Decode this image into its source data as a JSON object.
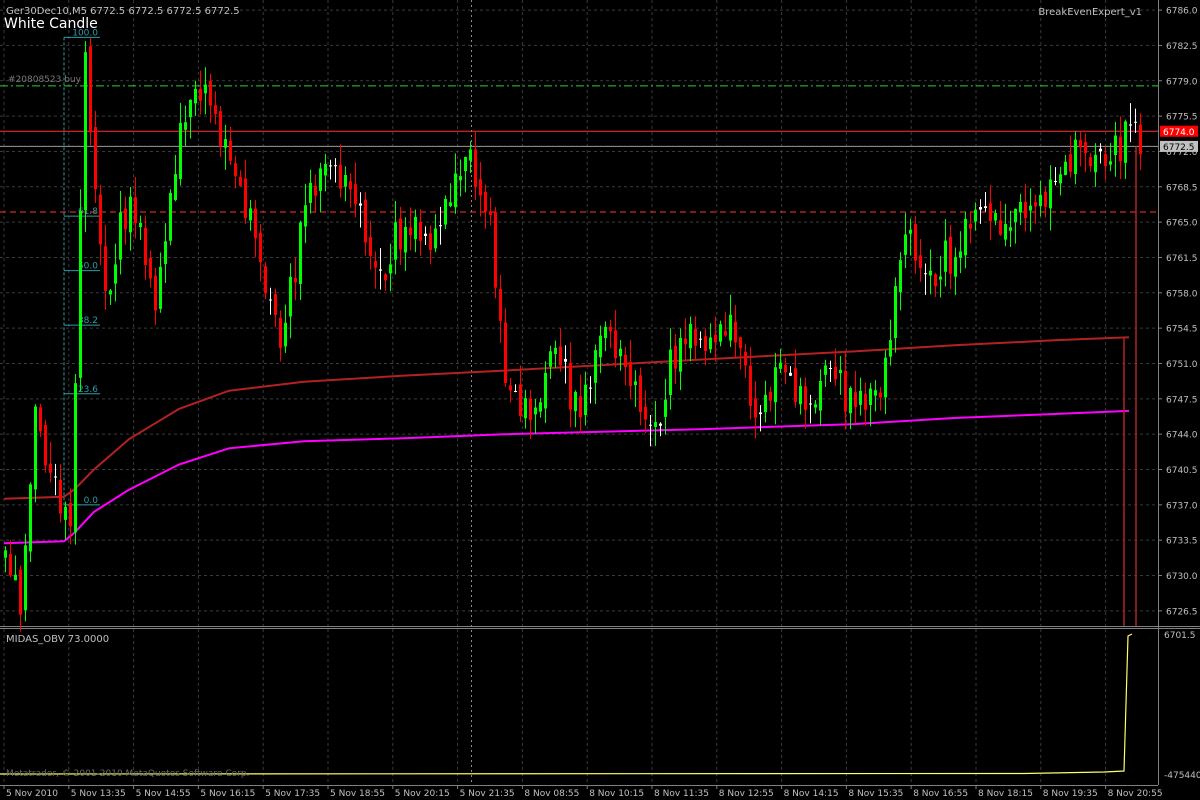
{
  "header": {
    "symbol_info": "Ger30Dec10,M5  6772.5 6772.5 6772.5 6772.5",
    "pattern_label": "White Candle",
    "expert_name": "BreakEvenExpert_v1",
    "order_label": "#20808523 buy",
    "copyright": "Metatrader, © 2001-2010 MetaQuotes Software Corp."
  },
  "colors": {
    "background": "#000000",
    "grid": "#3a3a3a",
    "bull": "#00ff00",
    "bear": "#ff0000",
    "doji": "#ffffff",
    "midas_red": "#b22222",
    "midas_magenta": "#ff00ff",
    "fib": "#2e9da7",
    "order_line": "#32cd32",
    "resistance": "#ff3333",
    "obv": "#ffff66",
    "axis_text": "#c0c0c0"
  },
  "price_axis": {
    "ticks": [
      "6786.0",
      "6782.5",
      "6779.0",
      "6775.5",
      "6772.0",
      "6768.5",
      "6765.0",
      "6761.5",
      "6758.0",
      "6754.5",
      "6751.0",
      "6747.5",
      "6744.0",
      "6740.5",
      "6737.0",
      "6733.5",
      "6730.0",
      "6726.5"
    ]
  },
  "price_tags": [
    {
      "label": "6774.0",
      "price": 6774.0,
      "bg": "#ff0000",
      "fg": "#ffffff"
    },
    {
      "label": "6772.5",
      "price": 6772.5,
      "bg": "#c0c0c0",
      "fg": "#000000"
    }
  ],
  "time_axis": {
    "labels": [
      "5 Nov 2010",
      "5 Nov 13:35",
      "5 Nov 14:55",
      "5 Nov 16:15",
      "5 Nov 17:35",
      "5 Nov 18:55",
      "5 Nov 20:15",
      "5 Nov 21:35",
      "8 Nov 08:55",
      "8 Nov 10:15",
      "8 Nov 11:35",
      "8 Nov 12:55",
      "8 Nov 14:15",
      "8 Nov 15:35",
      "8 Nov 16:55",
      "8 Nov 18:15",
      "8 Nov 19:35",
      "8 Nov 20:55"
    ]
  },
  "fibonacci": {
    "levels": [
      {
        "label": "100.0",
        "price": 6783.3
      },
      {
        "label": "61.8",
        "price": 6765.6
      },
      {
        "label": "50.0",
        "price": 6760.2
      },
      {
        "label": "38.2",
        "price": 6754.8
      },
      {
        "label": "23.6",
        "price": 6748.0
      },
      {
        "label": "0.0",
        "price": 6737.0
      }
    ]
  },
  "horizontal_lines": [
    {
      "name": "order-line",
      "price": 6778.5,
      "style": "dashdot"
    },
    {
      "name": "resistance-line",
      "price": 6774.0,
      "style": "solid"
    },
    {
      "name": "bid-line",
      "price": 6772.5,
      "style": "solid"
    },
    {
      "name": "support-dashed-line",
      "price": 6766.0,
      "style": "dashed"
    }
  ],
  "indicator_panel": {
    "title": "MIDAS_OBV 73.0000",
    "axis_labels": [
      "6701.5",
      "-475440"
    ]
  },
  "chart_data": {
    "type": "candlestick",
    "ylim": [
      6725.0,
      6787.0
    ],
    "price_segments": [
      [
        0,
        6732
      ],
      [
        3,
        6727
      ],
      [
        6,
        6745
      ],
      [
        10,
        6738
      ],
      [
        13,
        6736
      ],
      [
        16,
        6780
      ],
      [
        20,
        6758
      ],
      [
        25,
        6768
      ],
      [
        30,
        6756
      ],
      [
        35,
        6775
      ],
      [
        40,
        6780
      ],
      [
        45,
        6770
      ],
      [
        50,
        6763
      ],
      [
        55,
        6752
      ],
      [
        60,
        6766
      ],
      [
        65,
        6772
      ],
      [
        70,
        6766
      ],
      [
        75,
        6760
      ],
      [
        80,
        6765
      ],
      [
        85,
        6762
      ],
      [
        90,
        6770
      ],
      [
        93,
        6772
      ],
      [
        97,
        6766
      ],
      [
        100,
        6748
      ],
      [
        105,
        6745
      ],
      [
        110,
        6752
      ],
      [
        115,
        6745
      ],
      [
        120,
        6756
      ],
      [
        125,
        6748
      ],
      [
        130,
        6745
      ],
      [
        135,
        6754
      ],
      [
        140,
        6752
      ],
      [
        145,
        6756
      ],
      [
        150,
        6747
      ],
      [
        155,
        6750
      ],
      [
        160,
        6746
      ],
      [
        165,
        6750
      ],
      [
        170,
        6746
      ],
      [
        175,
        6749
      ],
      [
        180,
        6763
      ],
      [
        185,
        6760
      ],
      [
        190,
        6762
      ],
      [
        195,
        6766
      ],
      [
        200,
        6765
      ],
      [
        205,
        6768
      ],
      [
        210,
        6768
      ],
      [
        215,
        6772
      ],
      [
        220,
        6770
      ],
      [
        225,
        6774
      ],
      [
        227,
        6772.5
      ]
    ],
    "midas_red": [
      [
        0,
        6737.6
      ],
      [
        12,
        6737.8
      ],
      [
        14,
        6738.5
      ],
      [
        18,
        6740.5
      ],
      [
        25,
        6743.5
      ],
      [
        35,
        6746.5
      ],
      [
        45,
        6748.3
      ],
      [
        60,
        6749.2
      ],
      [
        80,
        6749.8
      ],
      [
        100,
        6750.3
      ],
      [
        140,
        6751.4
      ],
      [
        170,
        6752.2
      ],
      [
        190,
        6752.8
      ],
      [
        210,
        6753.3
      ],
      [
        225,
        6753.6
      ]
    ],
    "midas_magenta": [
      [
        0,
        6733.2
      ],
      [
        12,
        6733.4
      ],
      [
        14,
        6734.2
      ],
      [
        18,
        6736.3
      ],
      [
        25,
        6738.5
      ],
      [
        35,
        6741.0
      ],
      [
        45,
        6742.6
      ],
      [
        60,
        6743.3
      ],
      [
        80,
        6743.6
      ],
      [
        100,
        6744.0
      ],
      [
        140,
        6744.5
      ],
      [
        170,
        6745.0
      ],
      [
        190,
        6745.6
      ],
      [
        210,
        6746.0
      ],
      [
        225,
        6746.3
      ]
    ],
    "obv_step_index": 224
  }
}
